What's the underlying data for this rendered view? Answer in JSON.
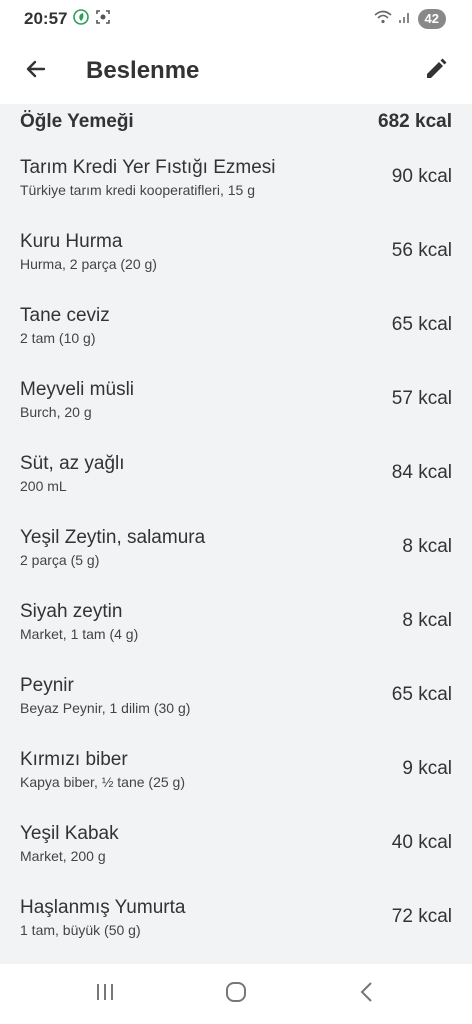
{
  "status_bar": {
    "time": "20:57",
    "battery": "42",
    "icons": [
      "leaf-icon",
      "screen-record-icon",
      "wifi-icon",
      "signal-icon"
    ]
  },
  "app_bar": {
    "title": "Beslenme",
    "back_icon": "arrow-left-icon",
    "edit_icon": "pencil-icon"
  },
  "meal": {
    "name": "Öğle Yemeği",
    "total": "682 kcal",
    "items": [
      {
        "name": "Tarım Kredi Yer Fıstığı Ezmesi",
        "desc": "Türkiye tarım kredi kooperatifleri, 15 g",
        "kcal": "90 kcal"
      },
      {
        "name": "Kuru Hurma",
        "desc": "Hurma, 2 parça (20 g)",
        "kcal": "56 kcal"
      },
      {
        "name": "Tane ceviz",
        "desc": "2 tam (10 g)",
        "kcal": "65 kcal"
      },
      {
        "name": "Meyveli müsli",
        "desc": "Burch, 20 g",
        "kcal": "57 kcal"
      },
      {
        "name": "Süt, az yağlı",
        "desc": "200 mL",
        "kcal": "84 kcal"
      },
      {
        "name": "Yeşil Zeytin, salamura",
        "desc": "2 parça (5 g)",
        "kcal": "8 kcal"
      },
      {
        "name": "Siyah zeytin",
        "desc": "Market, 1 tam (4 g)",
        "kcal": "8 kcal"
      },
      {
        "name": "Peynir",
        "desc": "Beyaz Peynir, 1 dilim (30 g)",
        "kcal": "65 kcal"
      },
      {
        "name": "Kırmızı biber",
        "desc": "Kapya biber, ½ tane (25 g)",
        "kcal": "9 kcal"
      },
      {
        "name": "Yeşil Kabak",
        "desc": "Market, 200 g",
        "kcal": "40 kcal"
      },
      {
        "name": "Haşlanmış Yumurta",
        "desc": "1 tam, büyük (50 g)",
        "kcal": "72 kcal"
      }
    ]
  },
  "nav_bar": {
    "icons": [
      "recent-apps-icon",
      "home-icon",
      "back-icon"
    ]
  },
  "colors": {
    "background": "#ffffff",
    "list_background": "#f2f3f5",
    "text": "#333333",
    "accent_leaf": "#2e9e5b"
  }
}
